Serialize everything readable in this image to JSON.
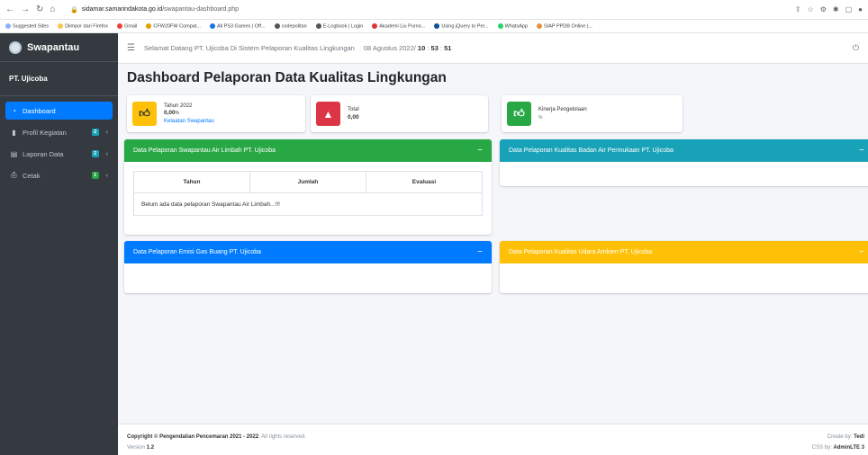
{
  "browser": {
    "url_host": "sidamar.samarindakota.go.id",
    "url_path": "/swapantau-dashboard.php",
    "bookmarks": [
      "Suggested Sites",
      "Diimpor dari Firefox",
      "Gmail",
      "CFW20FW Compat...",
      "All PS3 Games | Off...",
      "codepolitan",
      "E-Logbook | Login",
      "Akademi Liu Purno...",
      "Using jQuery to Per...",
      "WhatsApp",
      "SIAP PPDB Online |..."
    ]
  },
  "brand": {
    "name": "Swapantau"
  },
  "user": {
    "name": "PT. Ujicoba"
  },
  "menu": [
    {
      "label": "Dashboard",
      "badge": ""
    },
    {
      "label": "Profil Kegiatan",
      "badge": "2"
    },
    {
      "label": "Laporan Data",
      "badge": "2"
    },
    {
      "label": "Cetak",
      "badge": "1"
    }
  ],
  "topbar": {
    "greeting": "Selamat Datang PT. Ujicoba Di Sistem Pelaporan Kualitas Lingkungan",
    "date": "08 Agustus 2022/",
    "hh": "10",
    "mm": "53",
    "ss": "51"
  },
  "page_title": "Dashboard Pelaporan Data Kualitas Lingkungan",
  "info_boxes": [
    {
      "title": "Tahun 2022",
      "value": "0,00",
      "unit": "%",
      "link": "Ketaatan Swapantau",
      "color": "#ffc107"
    },
    {
      "title": "Total",
      "value": "0,00",
      "color": "#dc3545"
    },
    {
      "title": "Kinerja Pengelolaan",
      "unit": "%",
      "color": "#28a745"
    }
  ],
  "cards": {
    "air_limbah": {
      "title": "Data Pelaporan Swapantau Air Limbah PT. Ujicoba",
      "color": "#28a745",
      "columns": [
        "Tahun",
        "Jumlah",
        "Evaluasi"
      ],
      "empty_text": "Belum ada data pelaporan Swapantau Air Limbah...!!!"
    },
    "badan_air": {
      "title": "Data Pelaporan Kualitas Badan Air Permukaan PT. Ujicoba",
      "color": "#17a2b8"
    },
    "emisi": {
      "title": "Data Pelaporan Emisi Gas Buang PT. Ujicoba",
      "color": "#007bff"
    },
    "udara": {
      "title": "Data Pelaporan Kualitas Udara Ambien PT. Ujicoba",
      "color": "#ffc107"
    }
  },
  "footer": {
    "copyright_prefix": "Copyright ©",
    "copyright_org": "Pengendalian Pencemaran 2021 - 2022",
    "copyright_suffix": ". All rights reserved.",
    "version_label": "Version",
    "version": "1.2",
    "create_by_label": "Create by:",
    "create_by": "Tedi",
    "css_by_label": "CSS by:",
    "css_by": "AdminLTE 3"
  }
}
